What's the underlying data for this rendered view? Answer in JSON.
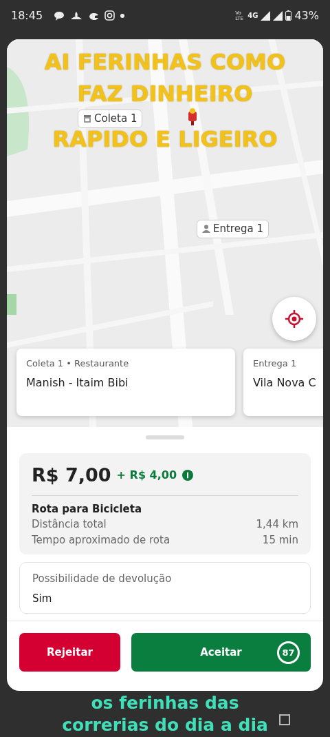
{
  "status_bar": {
    "time": "18:45",
    "volte": "Vo LTE",
    "network": "4G",
    "battery": "43%"
  },
  "map": {
    "markers": [
      {
        "kind": "pickup",
        "label": "Coleta 1"
      },
      {
        "kind": "dropoff",
        "label": "Entrega 1"
      }
    ]
  },
  "stops": [
    {
      "title": "Coleta 1",
      "separator": "•",
      "subtitle": "Restaurante",
      "name": "Manish - Itaim Bibi"
    },
    {
      "title": "Entrega 1",
      "name": "Vila Nova C"
    }
  ],
  "offer": {
    "price": "R$ 7,00",
    "bonus": "+ R$ 4,00",
    "route_title": "Rota para Bicicleta",
    "rows": [
      {
        "label": "Distância total",
        "value": "1,44 km"
      },
      {
        "label": "Tempo aproximado de rota",
        "value": "15 min"
      }
    ],
    "return": {
      "label": "Possibilidade de devolução",
      "value": "Sim"
    }
  },
  "buttons": {
    "reject": "Rejeitar",
    "accept": "Aceitar",
    "timer": "87"
  },
  "captions": [
    {
      "kind": "top",
      "lines": [
        "AI FERINHAS COMO",
        "FAZ DINHEIRO",
        "RAPIDO E LIGEIRO"
      ]
    },
    {
      "kind": "bottom",
      "lines": [
        "os ferinhas das",
        "correrias do dia a dia"
      ]
    }
  ]
}
